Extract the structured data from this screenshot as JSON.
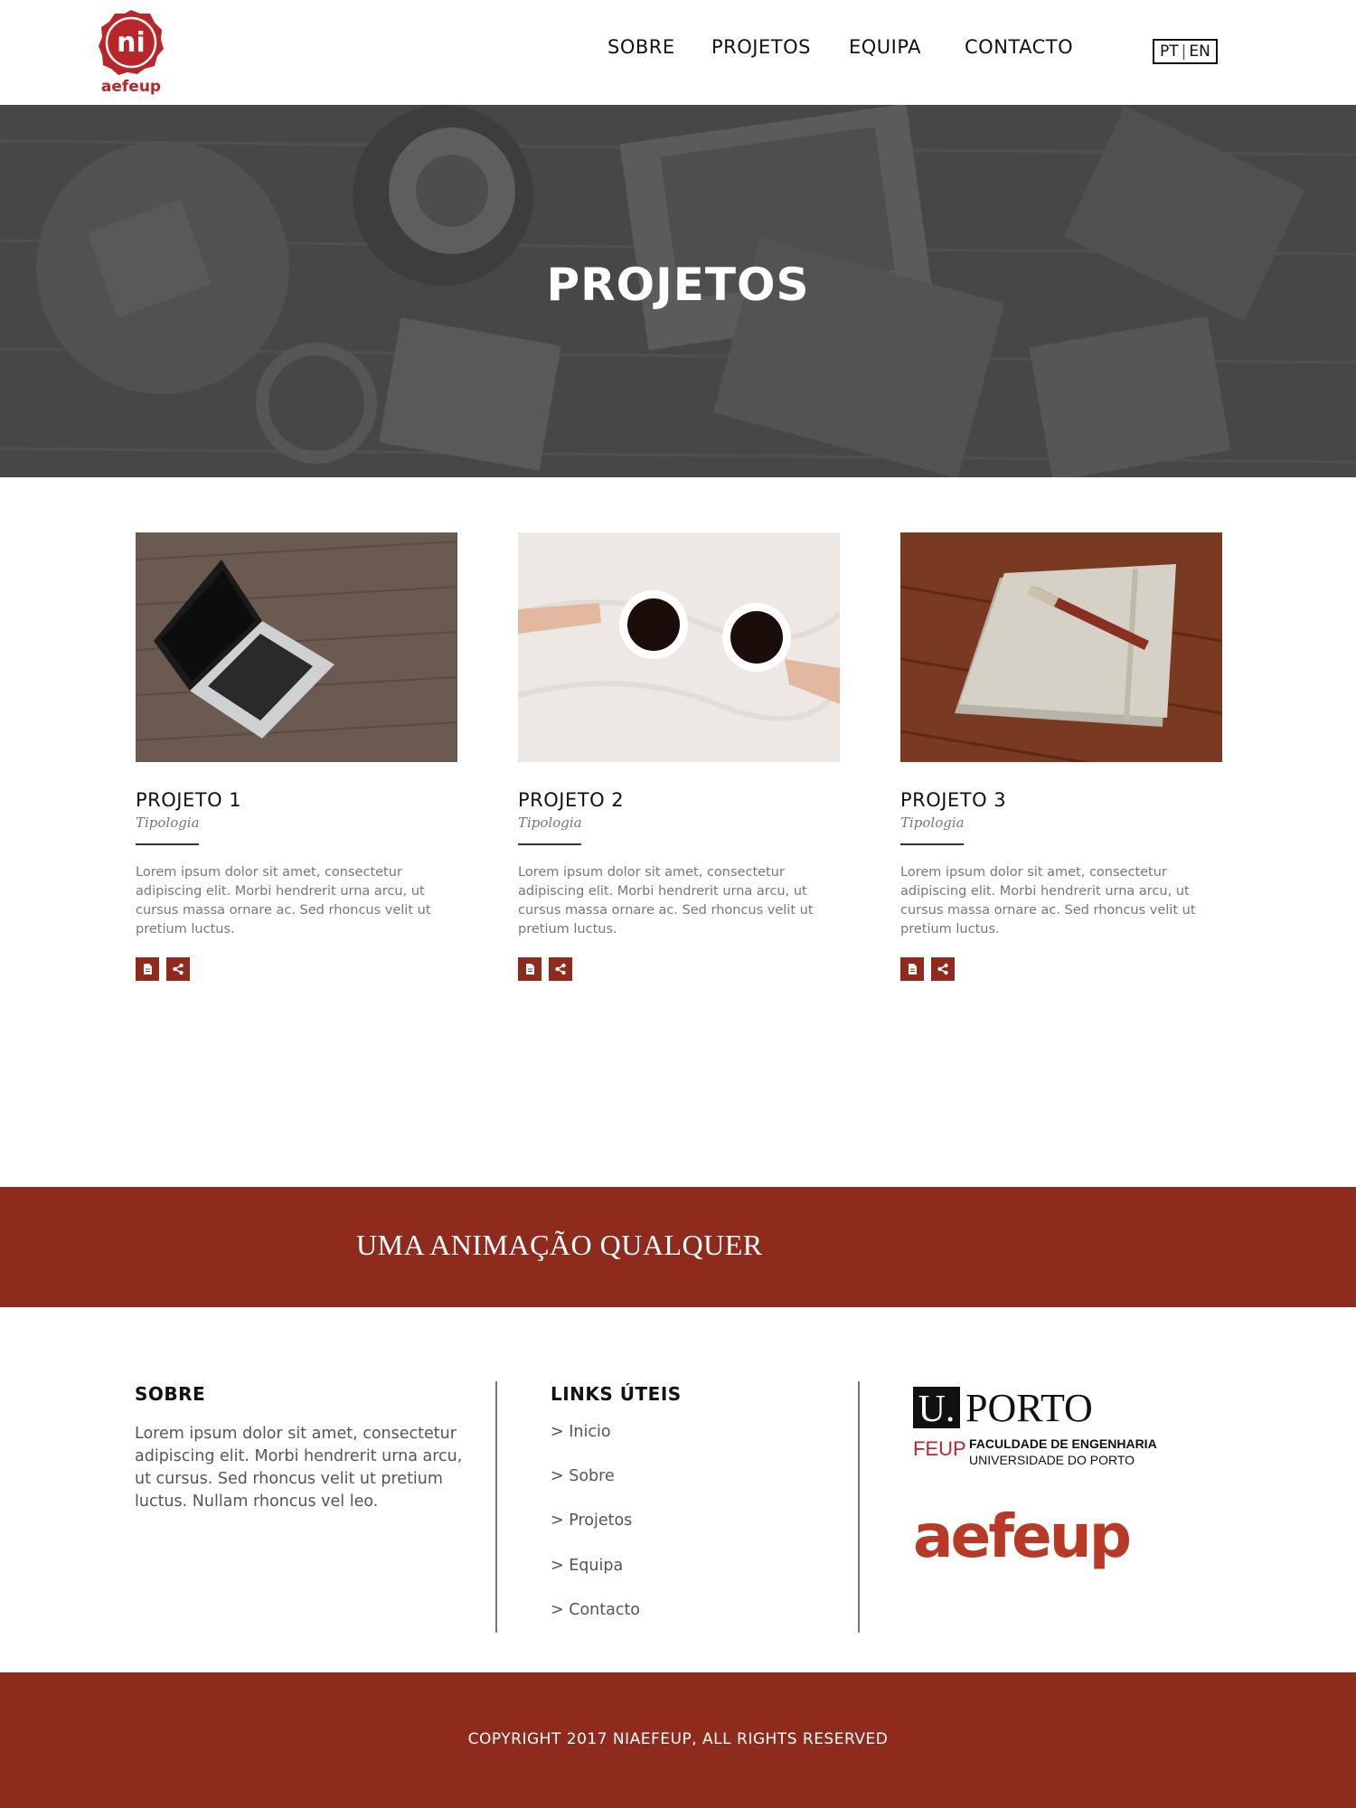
{
  "header": {
    "logo": {
      "badge_text": "ni",
      "caption": "aefeup"
    },
    "nav": [
      {
        "label": "SOBRE"
      },
      {
        "label": "PROJETOS"
      },
      {
        "label": "EQUIPA"
      },
      {
        "label": "CONTACTO"
      }
    ],
    "lang": {
      "pt": "PT",
      "sep": "|",
      "en": "EN"
    }
  },
  "hero": {
    "title": "PROJETOS"
  },
  "projects": [
    {
      "title": "PROJETO 1",
      "type": "Tipologia",
      "description": "Lorem ipsum dolor sit amet, consectetur adipiscing elit. Morbi hendrerit urna arcu, ut cursus massa ornare ac. Sed rhoncus velit ut pretium luctus.",
      "image": "laptop-on-wood"
    },
    {
      "title": "PROJETO 2",
      "type": "Tipologia",
      "description": "Lorem ipsum dolor sit amet, consectetur adipiscing elit. Morbi hendrerit urna arcu, ut cursus massa ornare ac. Sed rhoncus velit ut pretium luctus.",
      "image": "coffee-cups"
    },
    {
      "title": "PROJETO 3",
      "type": "Tipologia",
      "description": "Lorem ipsum dolor sit amet, consectetur adipiscing elit. Morbi hendrerit urna arcu, ut cursus massa ornare ac. Sed rhoncus velit ut pretium luctus.",
      "image": "notebook-pen"
    }
  ],
  "actions": {
    "document_icon": "document-icon",
    "share_icon": "share-icon"
  },
  "banner": {
    "text": "UMA ANIMAÇÃO QUALQUER"
  },
  "footer": {
    "about": {
      "title": "SOBRE",
      "text": "Lorem ipsum dolor sit amet, consectetur adipiscing elit. Morbi hendrerit urna arcu, ut cursus. Sed rhoncus velit ut pretium luctus. Nullam rhoncus vel leo."
    },
    "links": {
      "title": "LINKS ÚTEIS",
      "items": [
        "> Inicio",
        "> Sobre",
        "> Projetos",
        "> Equipa",
        "> Contacto"
      ]
    },
    "logos": {
      "uporto_mark": "U.",
      "uporto_name": "PORTO",
      "feup": "FEUP",
      "faculty": "FACULDADE DE ENGENHARIA",
      "university": "UNIVERSIDADE DO PORTO",
      "aefeup": "aefeup"
    }
  },
  "copyright": "COPYRIGHT 2017 NIAEFEUP, ALL RIGHTS RESERVED",
  "colors": {
    "brand": "#8e2b1d",
    "logo_red": "#b8262a"
  }
}
